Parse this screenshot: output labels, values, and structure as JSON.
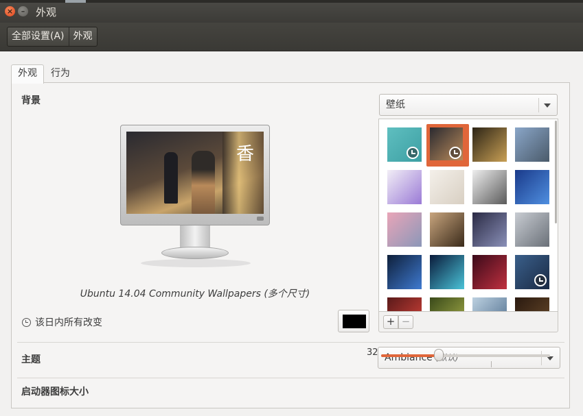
{
  "window": {
    "title": "外观",
    "close_glyph": "×",
    "minimize_glyph": "–"
  },
  "breadcrumb": [
    "全部设置(A)",
    "外观"
  ],
  "tabs": [
    {
      "label": "外观",
      "active": true
    },
    {
      "label": "行为",
      "active": false
    }
  ],
  "background": {
    "label": "背景",
    "source_combo": "壁纸",
    "preview_glyph": "香",
    "caption": "Ubuntu 14.04 Community Wallpapers (多个尺寸)",
    "change_text": "该日内所有改变",
    "color_value": "#000000",
    "add_glyph": "+",
    "remove_glyph": "−",
    "wallpapers": [
      {
        "colors": [
          "#5fbfc0",
          "#3d9fa3"
        ],
        "slideshow": true,
        "selected": false
      },
      {
        "colors": [
          "#2a2a30",
          "#b98a5a"
        ],
        "slideshow": true,
        "selected": true
      },
      {
        "colors": [
          "#2c2416",
          "#c9a055"
        ],
        "slideshow": false,
        "selected": false
      },
      {
        "colors": [
          "#8aa6c8",
          "#4a5a6a"
        ],
        "slideshow": false,
        "selected": false
      },
      {
        "colors": [
          "#f2eef6",
          "#9a7ad6"
        ],
        "slideshow": false,
        "selected": false
      },
      {
        "colors": [
          "#f4f0ea",
          "#d8cfc2"
        ],
        "slideshow": false,
        "selected": false
      },
      {
        "colors": [
          "#eeeeee",
          "#5a5a5a"
        ],
        "slideshow": false,
        "selected": false
      },
      {
        "colors": [
          "#1a3a8a",
          "#4f8fe0"
        ],
        "slideshow": false,
        "selected": false
      },
      {
        "colors": [
          "#e9a5b8",
          "#8b97b8"
        ],
        "slideshow": false,
        "selected": false
      },
      {
        "colors": [
          "#c8a57e",
          "#3a2a1a"
        ],
        "slideshow": false,
        "selected": false
      },
      {
        "colors": [
          "#2a2a44",
          "#8a90b8"
        ],
        "slideshow": false,
        "selected": false
      },
      {
        "colors": [
          "#c8ccd2",
          "#6a7078"
        ],
        "slideshow": false,
        "selected": false
      },
      {
        "colors": [
          "#0e1f3a",
          "#3f7ad0"
        ],
        "slideshow": false,
        "selected": false
      },
      {
        "colors": [
          "#0a1a3a",
          "#4ac3d8"
        ],
        "slideshow": false,
        "selected": false
      },
      {
        "colors": [
          "#3a0a1a",
          "#c0303f"
        ],
        "slideshow": false,
        "selected": false
      },
      {
        "colors": [
          "#3a5f8a",
          "#1a2a44"
        ],
        "slideshow": true,
        "selected": false
      },
      {
        "colors": [
          "#5a1a1a",
          "#d8443a"
        ],
        "slideshow": false,
        "selected": false
      },
      {
        "colors": [
          "#3a4a1a",
          "#a8b04a"
        ],
        "slideshow": false,
        "selected": false
      },
      {
        "colors": [
          "#bcd0e0",
          "#4a6a8a"
        ],
        "slideshow": false,
        "selected": false
      },
      {
        "colors": [
          "#2a1a10",
          "#6a4a2a"
        ],
        "slideshow": false,
        "selected": false
      }
    ]
  },
  "theme": {
    "label": "主题",
    "value": "Ambiance",
    "value_note": "(默认)"
  },
  "launcher": {
    "label": "启动器图标大小",
    "value": "32",
    "fraction": 0.34
  },
  "colors": {
    "accent": "#e0663a",
    "titlebar": "#3c3b37",
    "content_bg": "#f2f1f0"
  }
}
